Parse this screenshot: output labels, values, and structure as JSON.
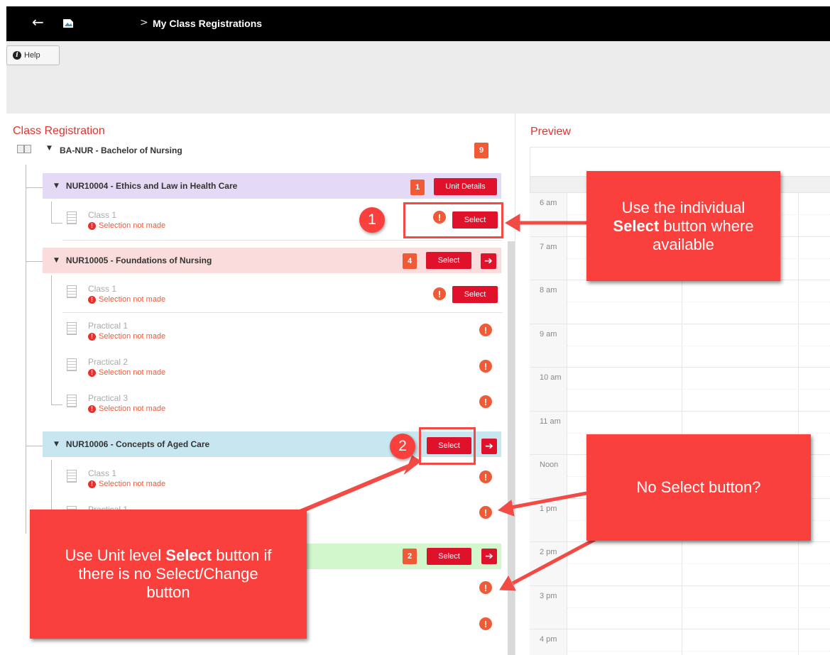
{
  "header": {
    "back_icon": "arrow-left-icon",
    "breadcrumb_sep": ">",
    "breadcrumb": "My Class Registrations"
  },
  "toolbar": {
    "help_label": "Help",
    "help_icon_glyph": "i"
  },
  "left": {
    "title": "Class Registration",
    "program": {
      "label": "BA-NUR - Bachelor of Nursing",
      "count": "9"
    },
    "units": [
      {
        "label": "NUR10004 - Ethics and Law in Health Care",
        "count": "1",
        "button": "Unit Details",
        "color": "#e5daf5",
        "classes": [
          {
            "name": "Class 1",
            "status": "Selection not made",
            "button": "Select"
          }
        ]
      },
      {
        "label": "NUR10005 - Foundations of Nursing",
        "count": "4",
        "button": "Select",
        "color": "#fbdcdc",
        "classes": [
          {
            "name": "Class 1",
            "status": "Selection not made",
            "button": "Select"
          },
          {
            "name": "Practical 1",
            "status": "Selection not made"
          },
          {
            "name": "Practical 2",
            "status": "Selection not made"
          },
          {
            "name": "Practical 3",
            "status": "Selection not made"
          }
        ]
      },
      {
        "label": "NUR10006 - Concepts of Aged Care",
        "button": "Select",
        "color": "#c7e6f0",
        "classes": [
          {
            "name": "Class 1",
            "status": "Selection not made"
          },
          {
            "name": "Practical 1"
          }
        ]
      },
      {
        "count": "2",
        "button": "Select",
        "color": "#d3f7cd"
      }
    ],
    "status_glyph": "!",
    "swap_glyph": "➔"
  },
  "preview": {
    "title": "Preview",
    "hours": [
      "6 am",
      "7 am",
      "8 am",
      "9 am",
      "10 am",
      "11 am",
      "Noon",
      "1 pm",
      "2 pm",
      "3 pm",
      "4 pm"
    ]
  },
  "annotations": {
    "step1": "1",
    "step2": "2",
    "callout1_pre": "Use the individual",
    "callout1_bold": "Select",
    "callout1_post": "button where available",
    "callout2": "No Select button?",
    "callout3_pre": "Use Unit level",
    "callout3_bold": "Select",
    "callout3_post": "button if there is no Select/Change button"
  },
  "colors": {
    "accent": "#e0112b",
    "badge": "#f15a37",
    "callout": "#f9403d",
    "title": "#e4312b"
  }
}
